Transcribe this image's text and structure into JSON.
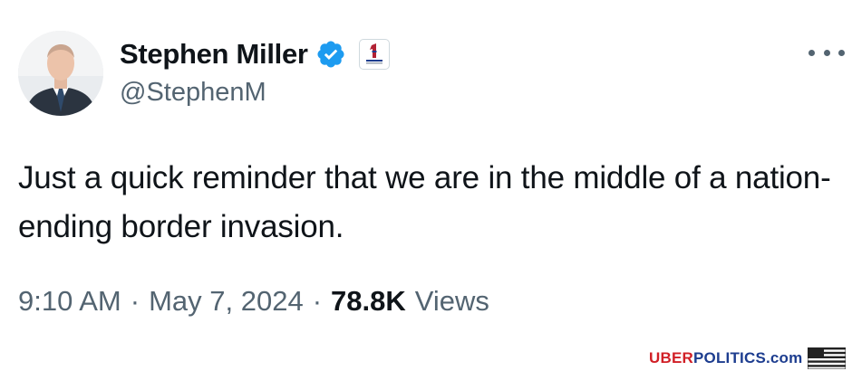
{
  "tweet": {
    "display_name": "Stephen Miller",
    "handle": "@StephenM",
    "verified": true,
    "affiliate_badge_icon": "america-first-badge-icon",
    "avatar_icon": "profile-avatar",
    "more_icon": "more-options-icon",
    "text": "Just a quick reminder that we are in the middle of a nation-ending border invasion.",
    "time": "9:10 AM",
    "date": "May 7, 2024",
    "separator": "·",
    "views_count": "78.8K",
    "views_label": "Views"
  },
  "watermark": {
    "part1": "UBER",
    "part2": "POLITICS",
    "part3": ".com",
    "flag_icon": "us-flag-icon"
  },
  "colors": {
    "verified_blue": "#1d9bf0",
    "secondary_text": "#536471",
    "primary_text": "#0f1419",
    "watermark_red": "#d11f26",
    "watermark_blue": "#1d3d8f"
  }
}
